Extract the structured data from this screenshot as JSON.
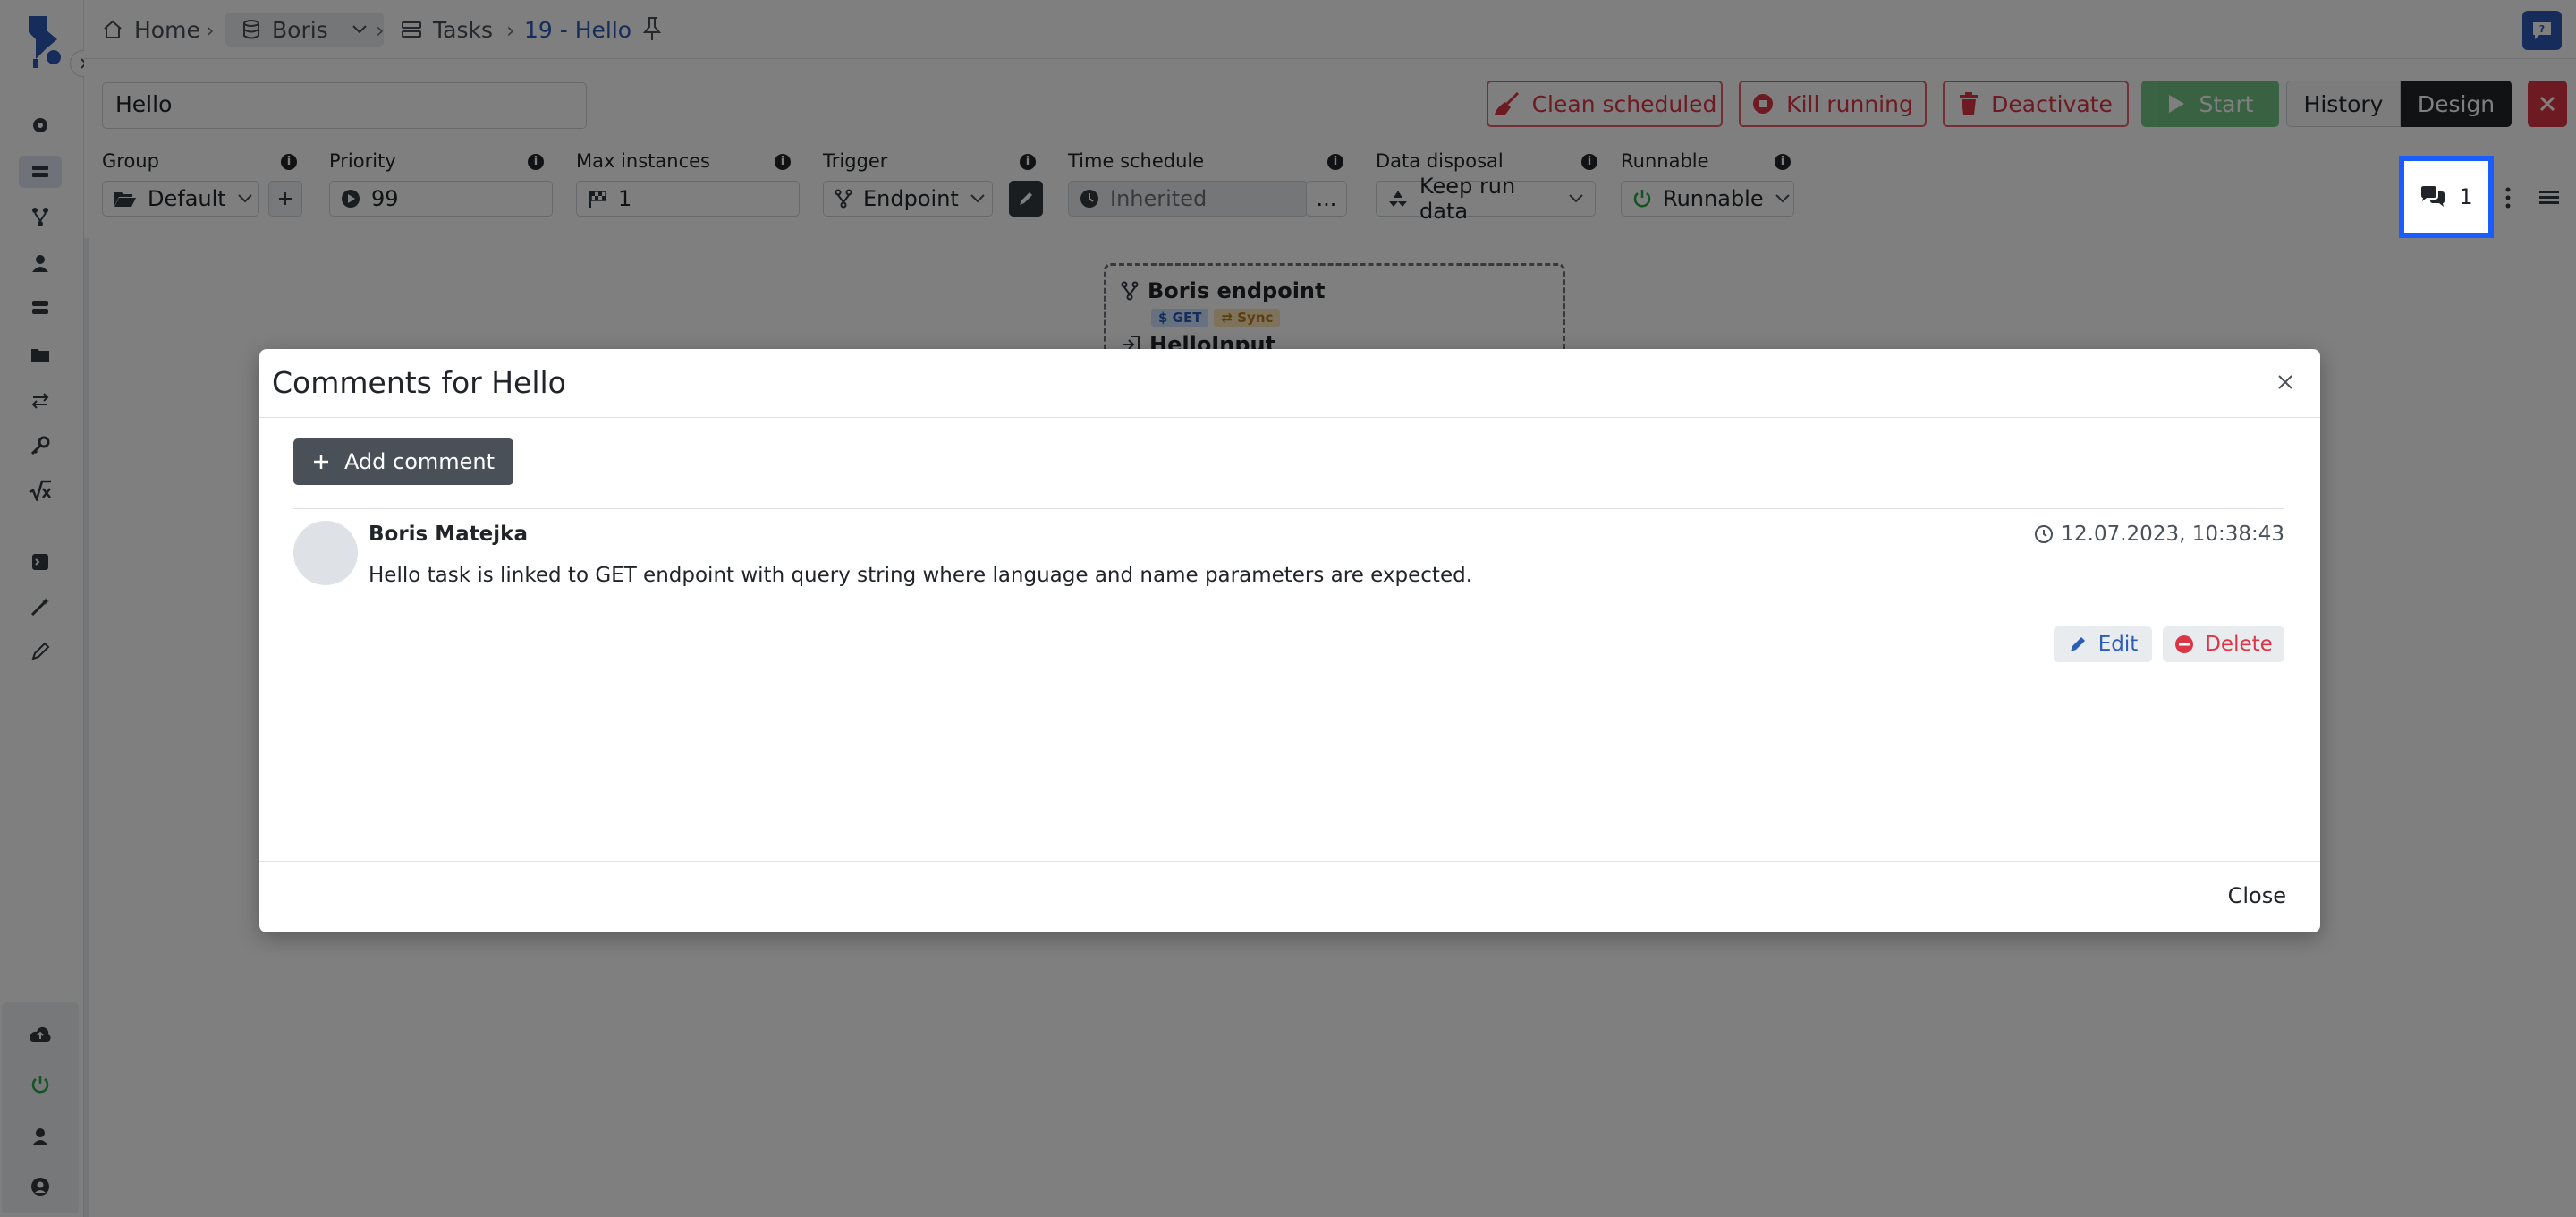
{
  "breadcrumb": {
    "home": "Home",
    "boris": "Boris",
    "tasks": "Tasks",
    "current": "19 - Hello"
  },
  "task": {
    "name_value": "Hello"
  },
  "toolbar": {
    "clean_scheduled": "Clean scheduled",
    "kill_running": "Kill running",
    "deactivate": "Deactivate",
    "start": "Start",
    "history": "History",
    "design": "Design"
  },
  "fields": {
    "group": {
      "label": "Group",
      "value": "Default"
    },
    "priority": {
      "label": "Priority",
      "value": "99"
    },
    "max_instances": {
      "label": "Max instances",
      "value": "1"
    },
    "trigger": {
      "label": "Trigger",
      "value": "Endpoint"
    },
    "time_schedule": {
      "label": "Time schedule",
      "value": "Inherited",
      "more": "..."
    },
    "data_disposal": {
      "label": "Data disposal",
      "value": "Keep run data"
    },
    "runnable": {
      "label": "Runnable",
      "value": "Runnable"
    }
  },
  "comments_count": "1",
  "node": {
    "title": "Boris endpoint",
    "badge_get": "$ GET",
    "badge_sync": "⇄ Sync",
    "input": "HelloInput"
  },
  "modal": {
    "title": "Comments for Hello",
    "add_comment": "Add comment",
    "comment": {
      "author": "Boris Matejka",
      "timestamp": "12.07.2023, 10:38:43",
      "text": "Hello task is linked to GET endpoint with query string where language and name parameters are expected.",
      "edit": "Edit",
      "delete": "Delete"
    },
    "close": "Close"
  },
  "colors": {
    "accent_blue": "#2c5bb8",
    "highlight": "#1a5cff",
    "danger": "#dc3545",
    "success": "#28a745"
  }
}
